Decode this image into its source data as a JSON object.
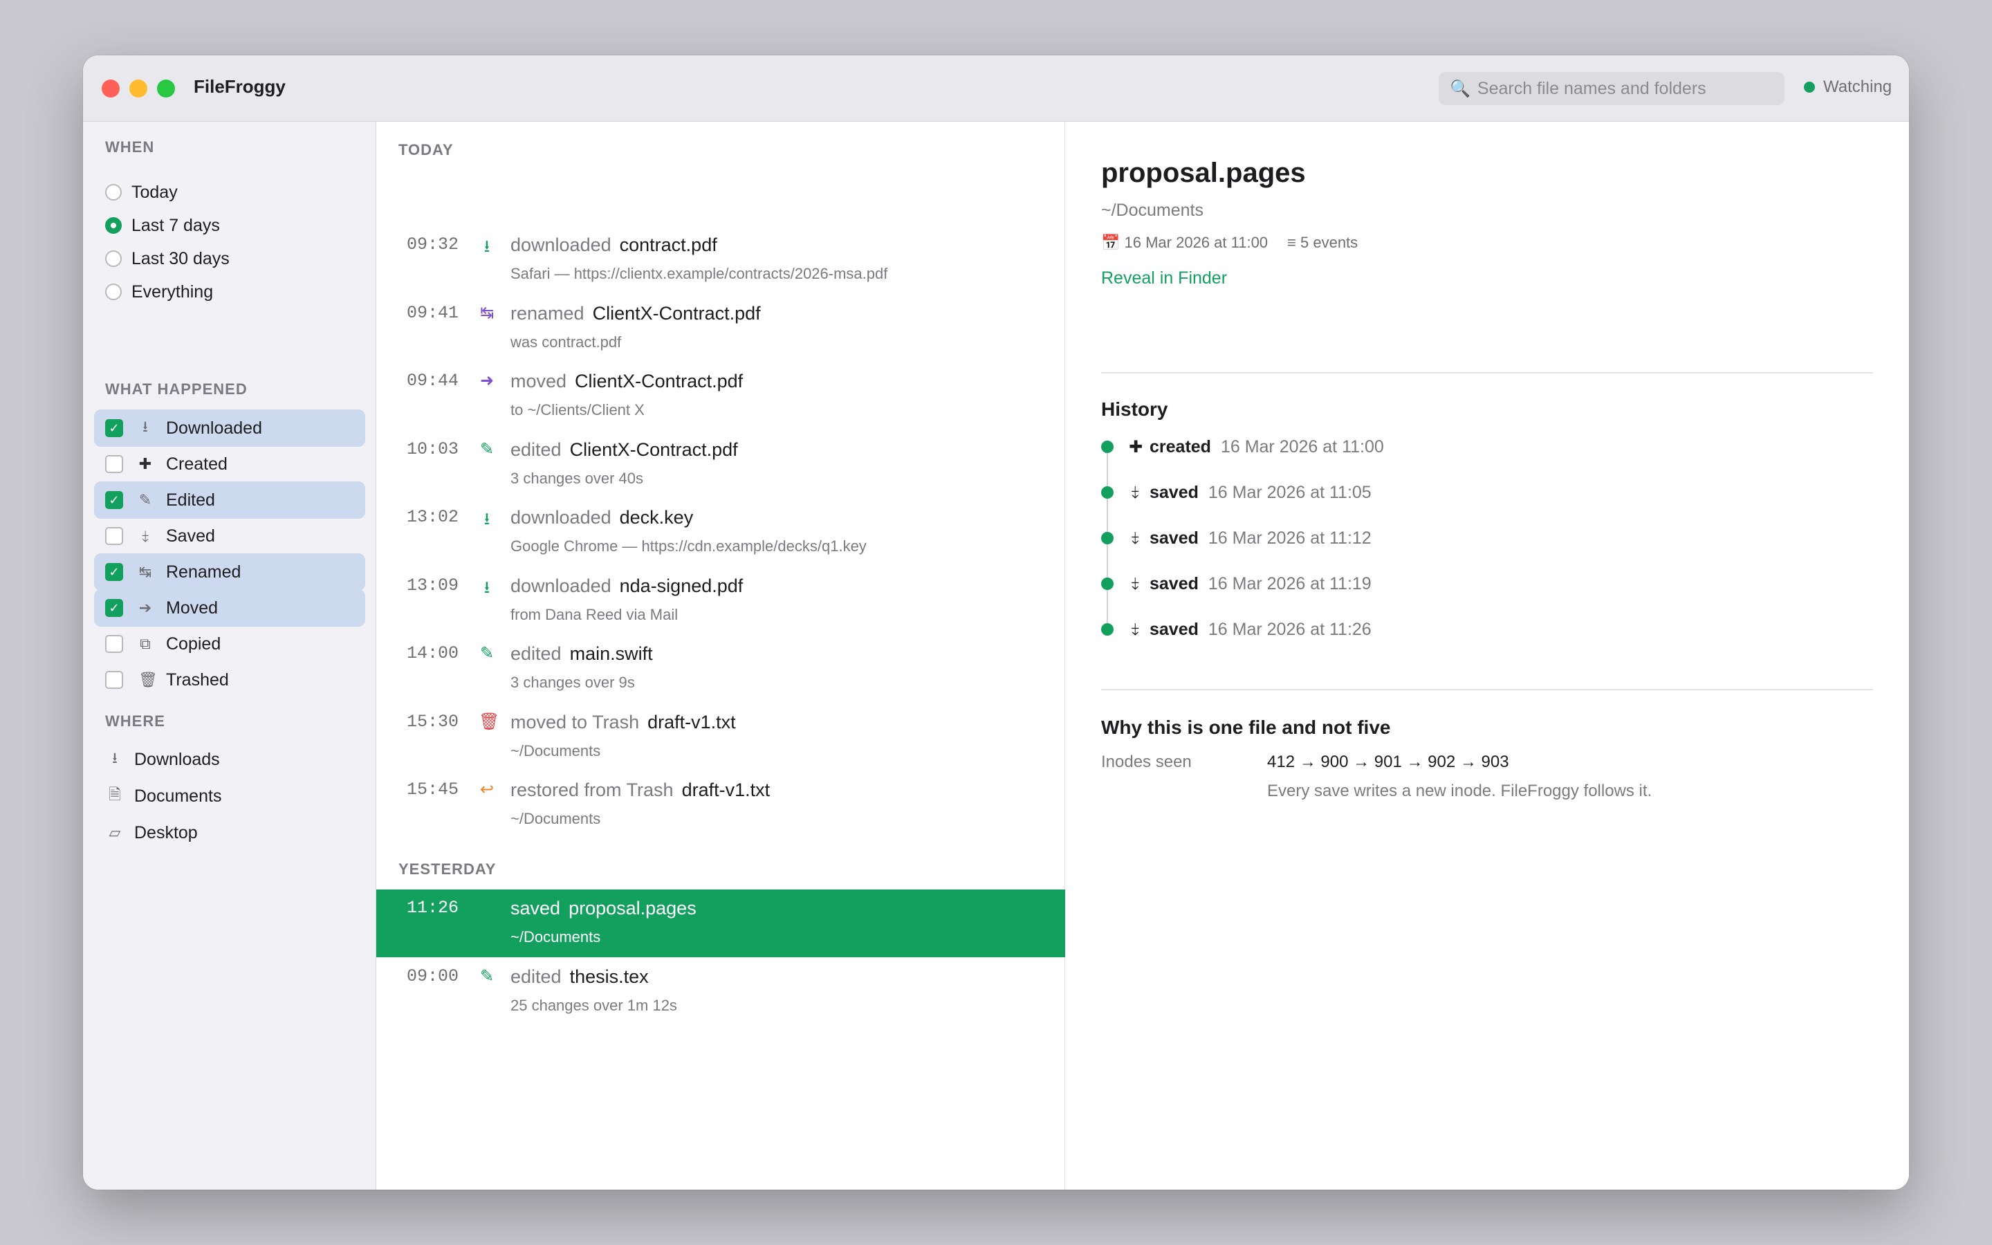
{
  "app": {
    "title": "FileFroggy",
    "status": "Watching"
  },
  "search": {
    "placeholder": "Search file names and folders"
  },
  "sidebar": {
    "when_title": "WHEN",
    "when_options": [
      {
        "label": "Today",
        "selected": false
      },
      {
        "label": "Last 7 days",
        "selected": true
      },
      {
        "label": "Last 30 days",
        "selected": false
      },
      {
        "label": "Everything",
        "selected": false
      }
    ],
    "what_title": "WHAT HAPPENED",
    "what_options": [
      {
        "label": "Downloaded",
        "checked": true,
        "icon": "download-icon",
        "glyph": "⭳"
      },
      {
        "label": "Created",
        "checked": false,
        "icon": "plus-icon",
        "glyph": "✚"
      },
      {
        "label": "Edited",
        "checked": true,
        "icon": "pencil-icon",
        "glyph": "✎"
      },
      {
        "label": "Saved",
        "checked": false,
        "icon": "save-icon",
        "glyph": "⤈"
      },
      {
        "label": "Renamed",
        "checked": true,
        "icon": "rename-icon",
        "glyph": "↹"
      },
      {
        "label": "Moved",
        "checked": true,
        "icon": "arrow-right-icon",
        "glyph": "➔"
      },
      {
        "label": "Copied",
        "checked": false,
        "icon": "copy-icon",
        "glyph": "⧉"
      },
      {
        "label": "Trashed",
        "checked": false,
        "icon": "trash-icon",
        "glyph": "🗑"
      }
    ],
    "where_title": "WHERE",
    "where_items": [
      {
        "label": "Downloads",
        "icon": "downloads-folder-icon",
        "glyph": "⭳"
      },
      {
        "label": "Documents",
        "icon": "document-icon",
        "glyph": "🗎"
      },
      {
        "label": "Desktop",
        "icon": "desktop-icon",
        "glyph": "▱"
      }
    ]
  },
  "timeline": {
    "today_label": "TODAY",
    "today": [
      {
        "time": "09:32",
        "verb": "downloaded",
        "name": "contract.pdf",
        "sub": "Safari — https://clientx.example/contracts/2026-msa.pdf",
        "icon": "download-icon",
        "glyph": "⭳",
        "color": "#13a05f"
      },
      {
        "time": "09:41",
        "verb": "renamed",
        "name": "ClientX-Contract.pdf",
        "sub": "was contract.pdf",
        "icon": "rename-icon",
        "glyph": "↹",
        "color": "#7d4fd6"
      },
      {
        "time": "09:44",
        "verb": "moved",
        "name": "ClientX-Contract.pdf",
        "sub": "to ~/Clients/Client X",
        "icon": "arrow-right-icon",
        "glyph": "➜",
        "color": "#7d4fd6"
      },
      {
        "time": "10:03",
        "verb": "edited",
        "name": "ClientX-Contract.pdf",
        "sub": "3 changes over 40s",
        "icon": "pencil-icon",
        "glyph": "✎",
        "color": "#13a05f"
      },
      {
        "time": "13:02",
        "verb": "downloaded",
        "name": "deck.key",
        "sub": "Google Chrome — https://cdn.example/decks/q1.key",
        "icon": "download-icon",
        "glyph": "⭳",
        "color": "#13a05f"
      },
      {
        "time": "13:09",
        "verb": "downloaded",
        "name": "nda-signed.pdf",
        "sub": "from Dana Reed via Mail",
        "icon": "download-icon",
        "glyph": "⭳",
        "color": "#13a05f"
      },
      {
        "time": "14:00",
        "verb": "edited",
        "name": "main.swift",
        "sub": "3 changes over 9s",
        "icon": "pencil-icon",
        "glyph": "✎",
        "color": "#13a05f"
      },
      {
        "time": "15:30",
        "verb": "moved to Trash",
        "name": "draft-v1.txt",
        "sub": "~/Documents",
        "icon": "trash-icon",
        "glyph": "🗑",
        "color": "#e0474c"
      },
      {
        "time": "15:45",
        "verb": "restored from Trash",
        "name": "draft-v1.txt",
        "sub": "~/Documents",
        "icon": "restore-icon",
        "glyph": "↩",
        "color": "#e8862a"
      }
    ],
    "yesterday_label": "YESTERDAY",
    "yesterday": [
      {
        "time": "11:26",
        "verb": "saved",
        "name": "proposal.pages",
        "sub": "~/Documents",
        "icon": "save-icon",
        "glyph": "⤈",
        "color": "#13a05f",
        "selected": true
      },
      {
        "time": "09:00",
        "verb": "edited",
        "name": "thesis.tex",
        "sub": "25 changes over 1m 12s",
        "icon": "pencil-icon",
        "glyph": "✎",
        "color": "#13a05f",
        "selected": false
      }
    ]
  },
  "detail": {
    "title": "proposal.pages",
    "path": "~/Documents",
    "created": "16 Mar 2026 at 11:00",
    "events": "5 events",
    "reveal_label": "Reveal in Finder",
    "history_title": "History",
    "history": [
      {
        "glyph": "✚",
        "icon": "plus-icon",
        "label": "created",
        "time": "16 Mar 2026 at 11:00"
      },
      {
        "glyph": "⤈",
        "icon": "save-icon",
        "label": "saved",
        "time": "16 Mar 2026 at 11:05"
      },
      {
        "glyph": "⤈",
        "icon": "save-icon",
        "label": "saved",
        "time": "16 Mar 2026 at 11:12"
      },
      {
        "glyph": "⤈",
        "icon": "save-icon",
        "label": "saved",
        "time": "16 Mar 2026 at 11:19"
      },
      {
        "glyph": "⤈",
        "icon": "save-icon",
        "label": "saved",
        "time": "16 Mar 2026 at 11:26"
      }
    ],
    "why_title": "Why this is one file and not five",
    "inodes_label": "Inodes seen",
    "inodes_value": "412 → 900 → 901 → 902 → 903",
    "inodes_note": "Every save writes a new inode. FileFroggy follows it."
  },
  "colors": {
    "accent": "#13a05f",
    "selection_bg": "#ccd9ef",
    "rename": "#7d4fd6",
    "trash": "#e0474c",
    "restore": "#e8862a"
  }
}
